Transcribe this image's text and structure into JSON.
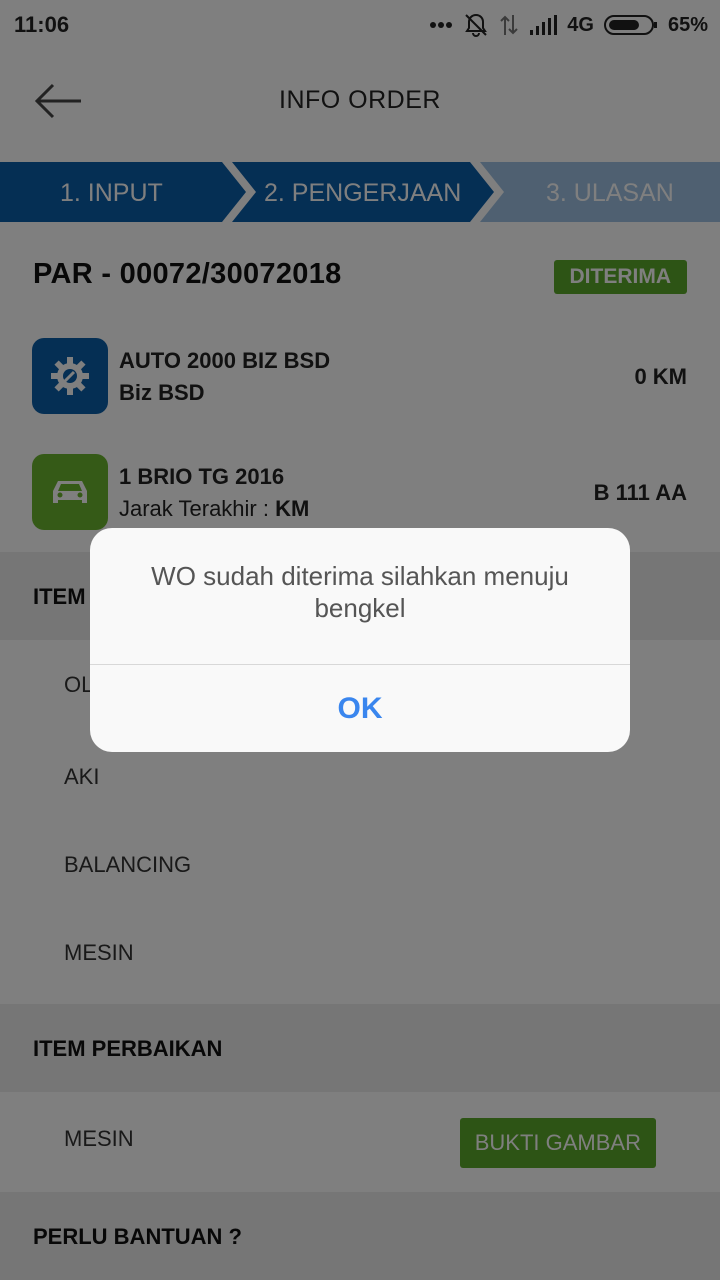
{
  "status_bar": {
    "time": "11:06",
    "network": "4G",
    "battery": "65%"
  },
  "app_bar": {
    "title": "INFO ORDER",
    "back_icon": "arrow-left-icon"
  },
  "stepper": {
    "steps": [
      {
        "label": "1. INPUT",
        "state": "done"
      },
      {
        "label": "2. PENGERJAAN",
        "state": "active"
      },
      {
        "label": "3. ULASAN",
        "state": "inactive"
      }
    ],
    "colors": {
      "active": "#0a5ea8",
      "inactive": "#9fc1e2"
    }
  },
  "order": {
    "number": "PAR - 00072/30072018",
    "status": "DITERIMA",
    "status_color": "#5ba82a"
  },
  "workshop": {
    "icon": "gear-wrench-icon",
    "name": "AUTO 2000 BIZ BSD",
    "branch": "Biz BSD",
    "distance": "0 KM"
  },
  "vehicle": {
    "icon": "car-icon",
    "name": "1 BRIO TG 2016",
    "last_distance_label": "Jarak Terakhir : ",
    "last_distance_value": "KM",
    "plate": "B 111 AA"
  },
  "item_section": {
    "title": "ITEM",
    "items": [
      "OLI",
      "AKI",
      "BALANCING",
      "MESIN"
    ]
  },
  "repair_section": {
    "title": "ITEM PERBAIKAN",
    "item": "MESIN",
    "button_label": "BUKTI GAMBAR"
  },
  "help_section": {
    "title": "PERLU BANTUAN ?"
  },
  "dialog": {
    "message": "WO sudah diterima silahkan menuju bengkel",
    "ok_label": "OK"
  }
}
